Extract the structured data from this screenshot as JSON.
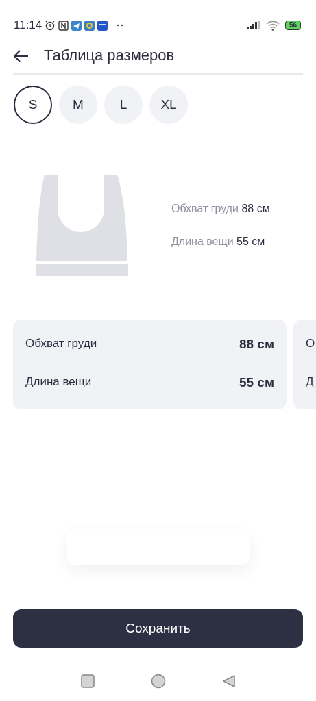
{
  "status_bar": {
    "time": "11:14",
    "battery": "56"
  },
  "header": {
    "title": "Таблица размеров"
  },
  "sizes": [
    {
      "label": "S",
      "selected": true
    },
    {
      "label": "M",
      "selected": false
    },
    {
      "label": "L",
      "selected": false
    },
    {
      "label": "XL",
      "selected": false
    }
  ],
  "summary": [
    {
      "label": "Обхват груди",
      "value": "88 см"
    },
    {
      "label": "Длина вещи",
      "value": "55 см"
    }
  ],
  "cards": [
    {
      "rows": [
        {
          "label": "Обхват груди",
          "value": "88 см"
        },
        {
          "label": "Длина вещи",
          "value": "55 см"
        }
      ]
    },
    {
      "rows": [
        {
          "label": "О"
        },
        {
          "label": "Д"
        }
      ]
    }
  ],
  "save_button": "Сохранить"
}
